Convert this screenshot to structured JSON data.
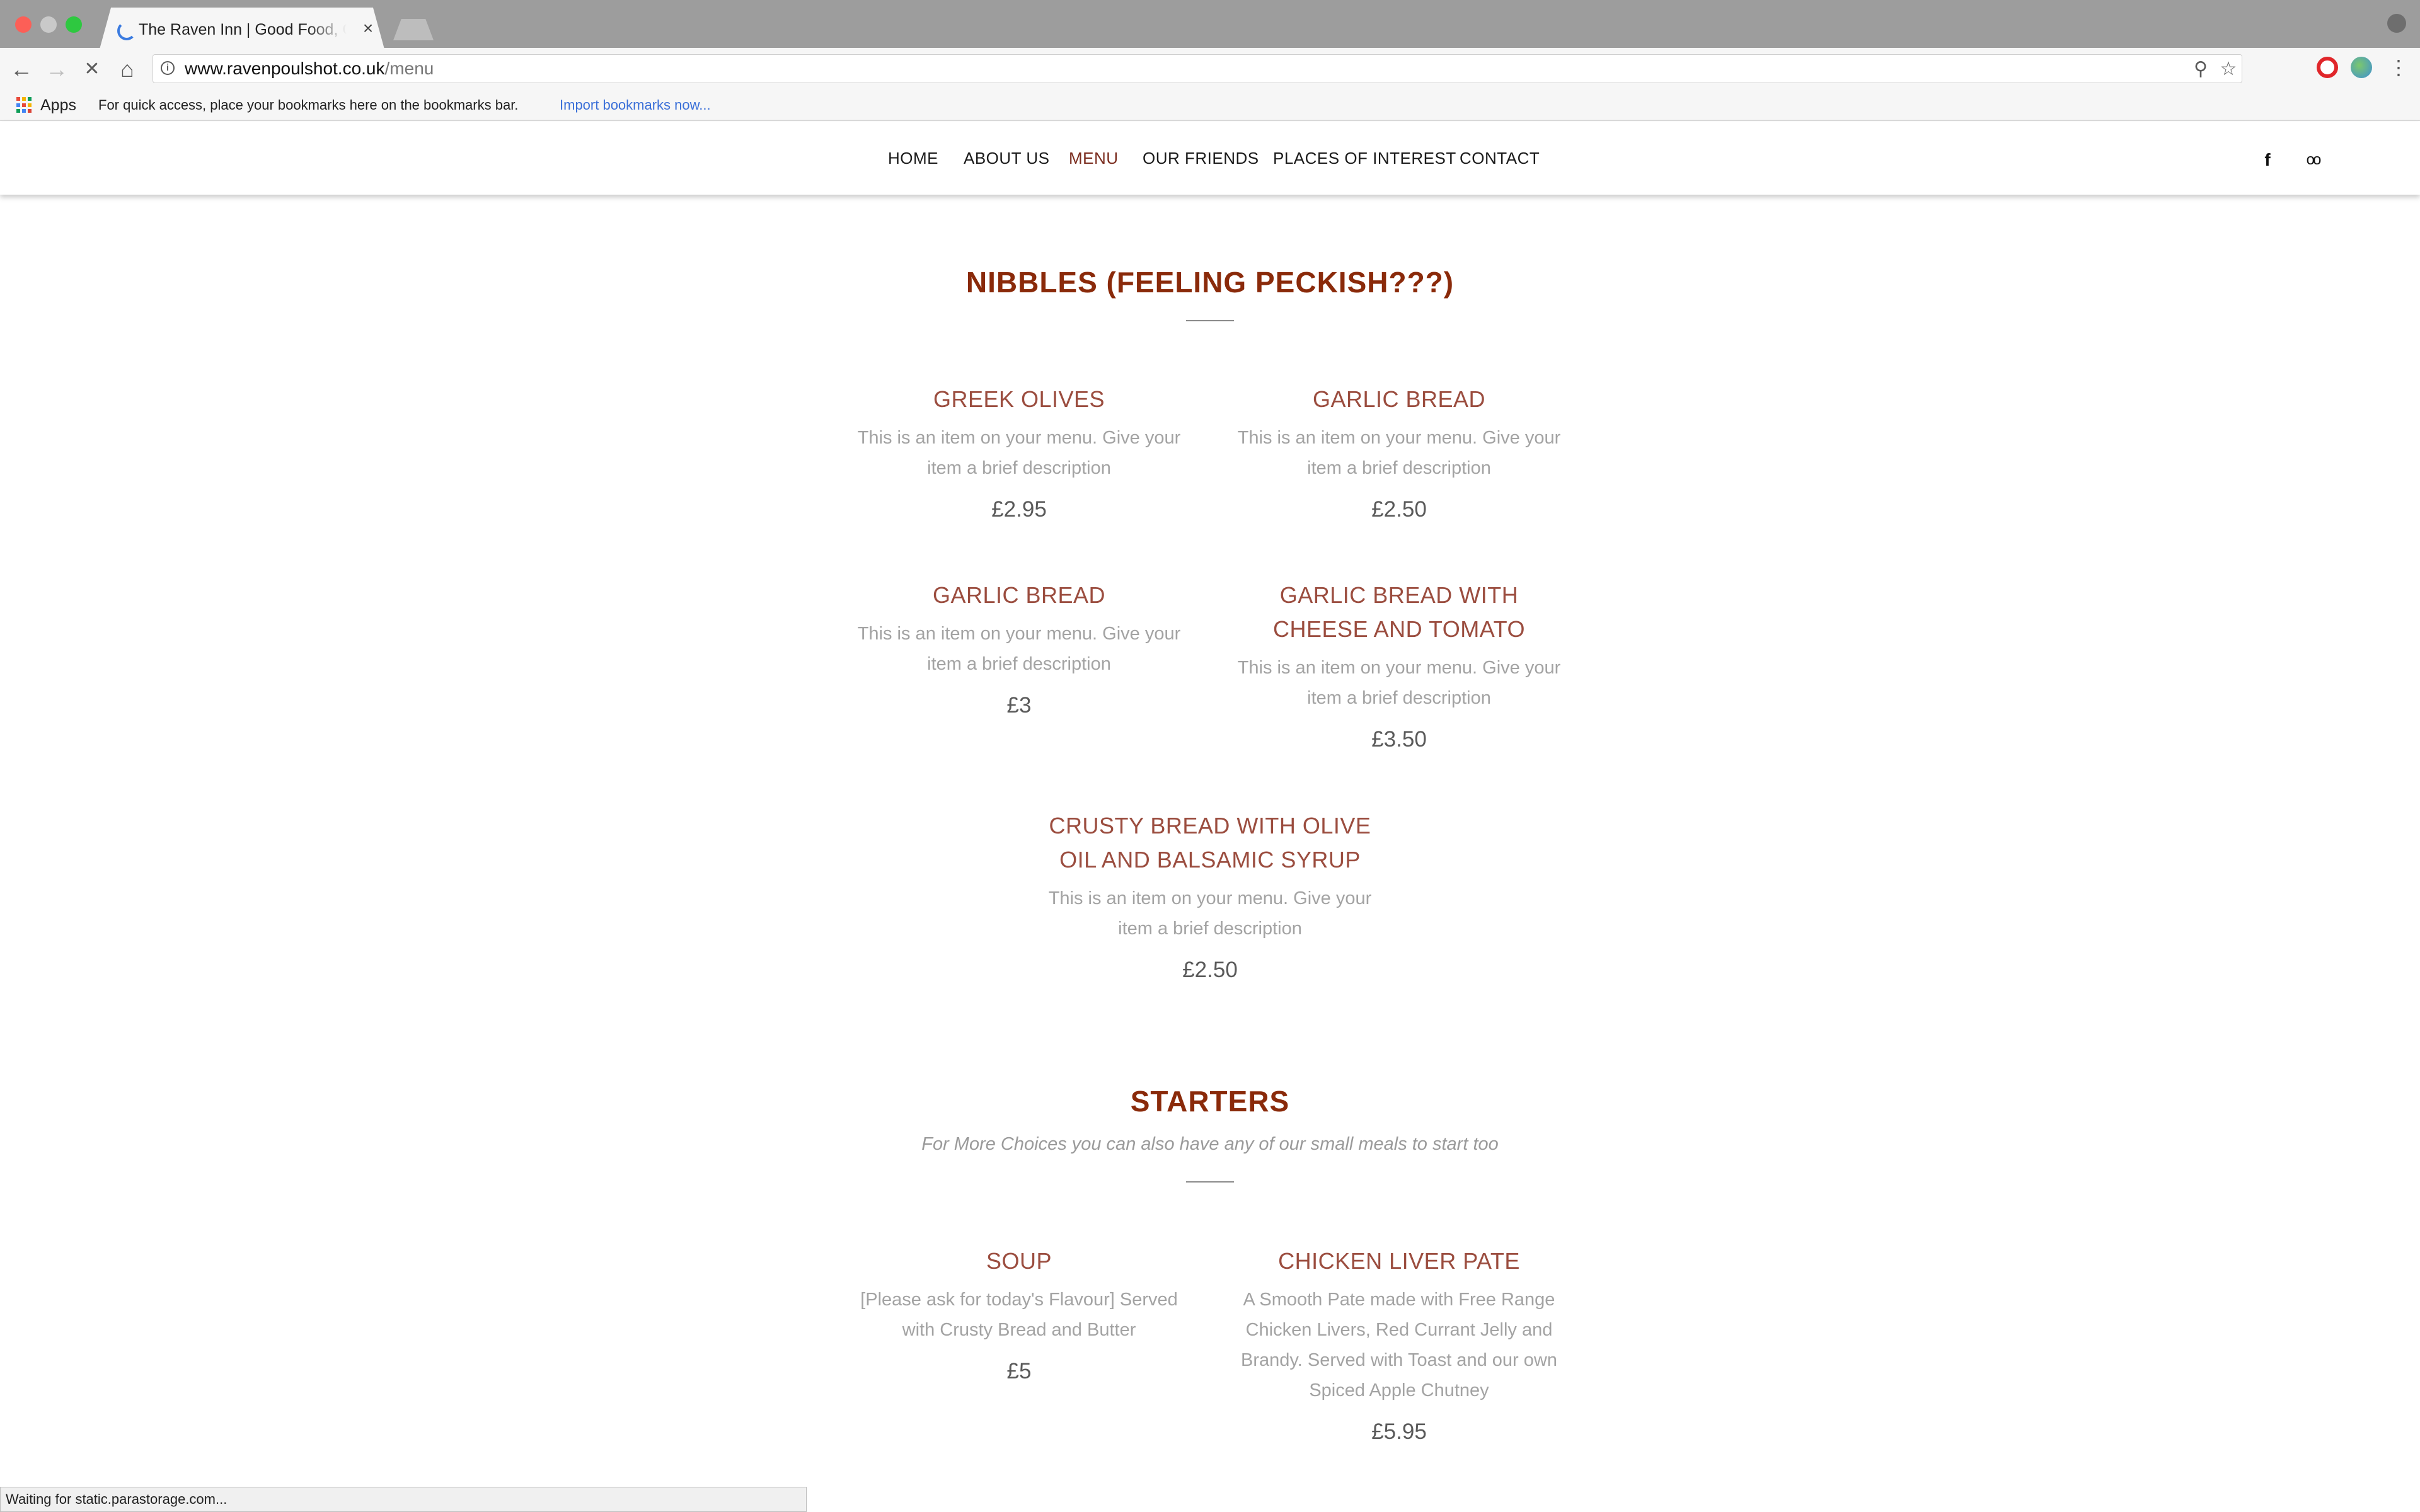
{
  "browser": {
    "tab_title": "The Raven Inn | Good Food, Good",
    "tab_close": "×",
    "url_host": "www.ravenpoulshot.co.uk",
    "url_path": "/menu",
    "back": "←",
    "forward": "→",
    "stop": "✕",
    "home": "⌂",
    "zoom": "⚲",
    "star": "☆",
    "menu": "⋮",
    "bookmarks": {
      "apps_label": "Apps",
      "hint": "For quick access, place your bookmarks here on the bookmarks bar.",
      "import_link": "Import bookmarks now..."
    },
    "status": "Waiting for static.parastorage.com...",
    "colors": {
      "apps_grid": [
        "#e84a3a",
        "#f4b400",
        "#0f9d58",
        "#4285f4",
        "#e84a3a",
        "#f4b400",
        "#0f9d58",
        "#4285f4",
        "#db4437"
      ]
    }
  },
  "site": {
    "nav": [
      "HOME",
      "ABOUT US",
      "MENU",
      "OUR FRIENDS",
      "PLACES OF INTEREST",
      "CONTACT"
    ],
    "active_nav": "MENU",
    "social": {
      "facebook": "f",
      "tripadvisor": "oo"
    },
    "colors": {
      "section_title": "#8a2a0a",
      "item_name": "#9b4d3f",
      "active_nav": "#7b2d1f"
    }
  },
  "sections": [
    {
      "title": "NIBBLES (FEELING PECKISH???)",
      "subtitle": "",
      "items": [
        {
          "name": "GREEK OLIVES",
          "desc": "This is an item on your menu. Give your item a brief description",
          "price": "£2.95"
        },
        {
          "name": "GARLIC BREAD",
          "desc": "This is an item on your menu. Give your item a brief description",
          "price": "£2.50"
        },
        {
          "name": "GARLIC BREAD",
          "desc": "This is an item on your menu. Give your item a brief description",
          "price": "£3"
        },
        {
          "name": "GARLIC BREAD WITH CHEESE AND TOMATO",
          "desc": "This is an item on your menu. Give your item a brief description",
          "price": "£3.50"
        },
        {
          "name": "CRUSTY BREAD WITH OLIVE OIL AND BALSAMIC SYRUP",
          "desc": "This is an item on your menu. Give your item a brief description",
          "price": "£2.50"
        }
      ]
    },
    {
      "title": "STARTERS",
      "subtitle": "For More Choices you can also have any of our small meals to start too",
      "items": [
        {
          "name": "SOUP",
          "desc": "[Please ask for today's Flavour] Served with Crusty Bread and Butter",
          "price": "£5"
        },
        {
          "name": "CHICKEN LIVER PATE",
          "desc": "A Smooth Pate made with Free Range Chicken Livers, Red Currant Jelly and Brandy. Served with Toast and our own Spiced Apple Chutney",
          "price": "£5.95"
        }
      ]
    }
  ]
}
